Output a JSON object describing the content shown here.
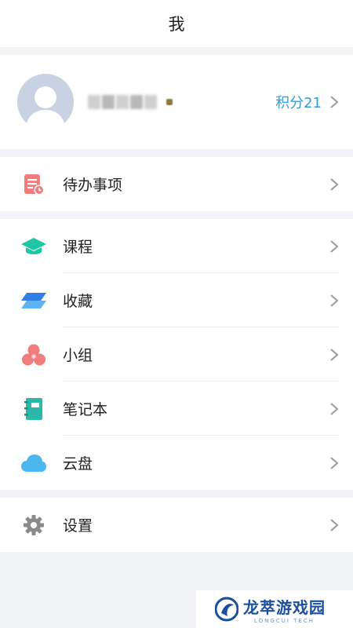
{
  "header": {
    "title": "我"
  },
  "profile": {
    "points_label": "积分21"
  },
  "todo": {
    "label": "待办事项"
  },
  "menu": {
    "items": [
      {
        "label": "课程",
        "icon": "graduation-cap-icon",
        "color": "#1fc6a6"
      },
      {
        "label": "收藏",
        "icon": "bookmark-layers-icon",
        "color": "#2f7fe6"
      },
      {
        "label": "小组",
        "icon": "group-icon",
        "color": "#f07c7c"
      },
      {
        "label": "笔记本",
        "icon": "notebook-icon",
        "color": "#2bb8a8"
      },
      {
        "label": "云盘",
        "icon": "cloud-icon",
        "color": "#4ab8ee"
      }
    ]
  },
  "settings": {
    "label": "设置"
  },
  "watermark": {
    "main": "龙萃游戏园",
    "sub": "LONGCUI TECH"
  },
  "colors": {
    "accent": "#2f9fd8",
    "background": "#f2f3f7"
  }
}
